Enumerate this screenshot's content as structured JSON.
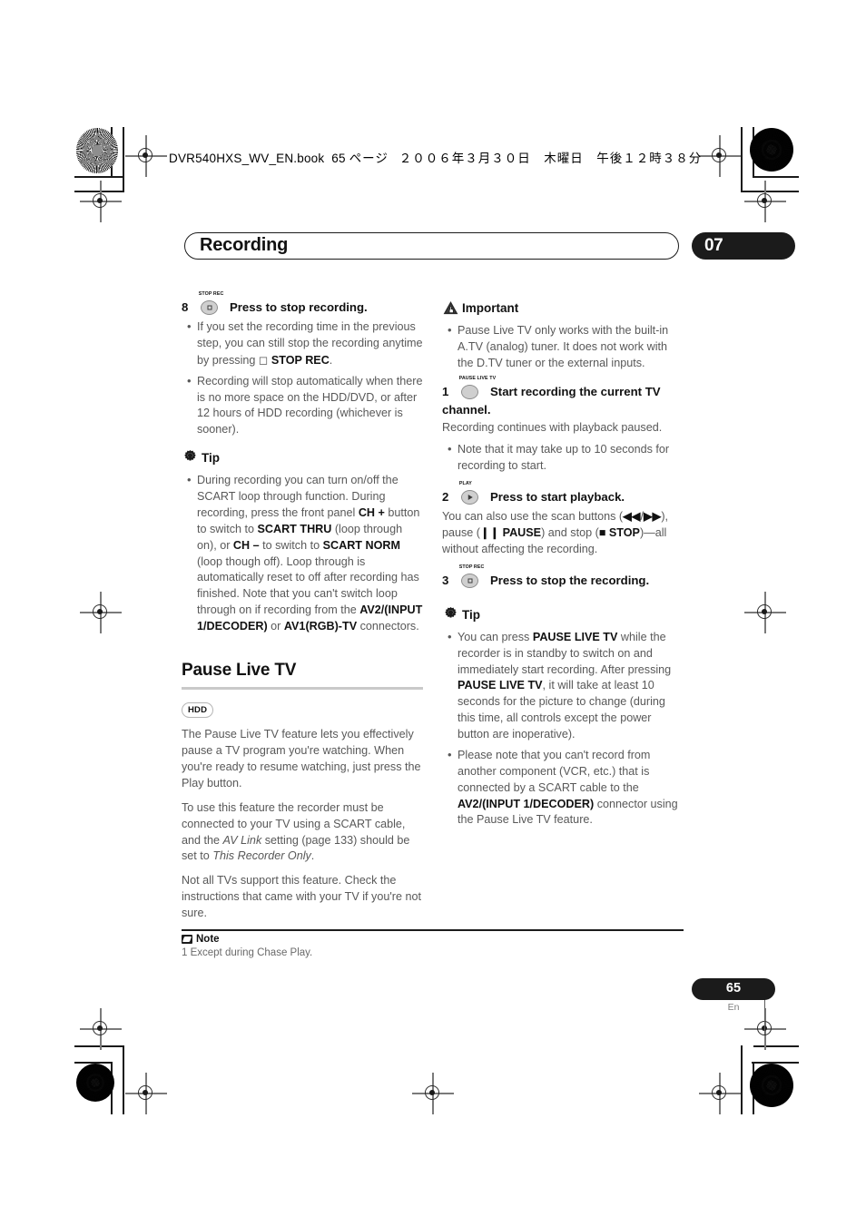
{
  "print_header": {
    "filename": "DVR540HXS_WV_EN.book",
    "page_label": "65",
    "page_unit": "ページ",
    "date": "２００６年３月３０日　木曜日　午後１２時３８分"
  },
  "header": {
    "chapter_title": "Recording",
    "chapter_number": "07"
  },
  "left_column": {
    "step8": {
      "number": "8",
      "button_label": "STOP REC",
      "button_glyph": "square",
      "instruction": "Press to stop recording."
    },
    "step8_bullets": [
      "If you set the recording time in the previous step, you can still stop the recording anytime by pressing □ STOP REC.",
      "Recording will stop automatically when there is no more space on the HDD/DVD, or after 12 hours of HDD recording (whichever is sooner)."
    ],
    "tip": {
      "title": "Tip",
      "icon": "gear-lightbulb-icon",
      "bullets": [
        "During recording you can turn on/off the SCART loop through function. During recording, press the front panel CH + button to switch to SCART THRU (loop through on), or CH – to switch to SCART NORM (loop though off). Loop through is automatically reset to off after recording has finished. Note that you can't switch loop through on if recording from the AV2/(INPUT 1/DECODER) or AV1(RGB)-TV connectors."
      ]
    },
    "section": {
      "heading": "Pause Live TV",
      "media_badge": "HDD",
      "paragraphs": [
        "The Pause Live TV feature lets you effectively pause a TV program you're watching. When you're ready to resume watching, just press the Play button.",
        "To use this feature the recorder must be connected to your TV using a SCART cable, and the AV Link setting (page 133) should be set to This Recorder Only.",
        "Not all TVs support this feature. Check the instructions that came with your TV if you're not sure."
      ]
    }
  },
  "right_column": {
    "important": {
      "title": "Important",
      "icon": "warning-hand-icon",
      "bullets": [
        "Pause Live TV only works with the built-in A.TV (analog) tuner. It does not work with the D.TV tuner or the external inputs."
      ]
    },
    "step1": {
      "number": "1",
      "button_label": "PAUSE LIVE TV",
      "button_glyph": "blank",
      "instruction": "Start recording the current TV channel.",
      "continuation": "Recording continues with playback paused.",
      "bullets": [
        "Note that it may take up to 10 seconds for recording to start."
      ]
    },
    "step2": {
      "number": "2",
      "button_label": "PLAY",
      "button_glyph": "triangle",
      "instruction": "Press to start playback.",
      "continuation": "You can also use the scan buttons (◄◄/►►), pause (Ⅱ PAUSE) and stop (■ STOP)—all without affecting the recording."
    },
    "step3": {
      "number": "3",
      "button_label": "STOP REC",
      "button_glyph": "square",
      "instruction": "Press to stop the recording."
    },
    "tip": {
      "title": "Tip",
      "icon": "gear-lightbulb-icon",
      "bullets": [
        "You can press PAUSE LIVE TV while the recorder is in standby to switch on and immediately start recording. After pressing PAUSE LIVE TV, it will take at least 10 seconds for the picture to change (during this time, all controls except the power button are inoperative).",
        "Please note that you can't record from another component (VCR, etc.) that is connected by a SCART cable to the AV2/(INPUT 1/DECODER) connector using the Pause Live TV feature."
      ]
    }
  },
  "footnote": {
    "title": "Note",
    "icon": "pencil-icon",
    "text": "1 Except during Chase Play."
  },
  "footer": {
    "page_number": "65",
    "language": "En"
  },
  "colors": {
    "ink_black": "#1b1b1b",
    "body_gray": "#585858",
    "rule_gray": "#c9c9c9",
    "button_fill": "#cfcfcf"
  }
}
